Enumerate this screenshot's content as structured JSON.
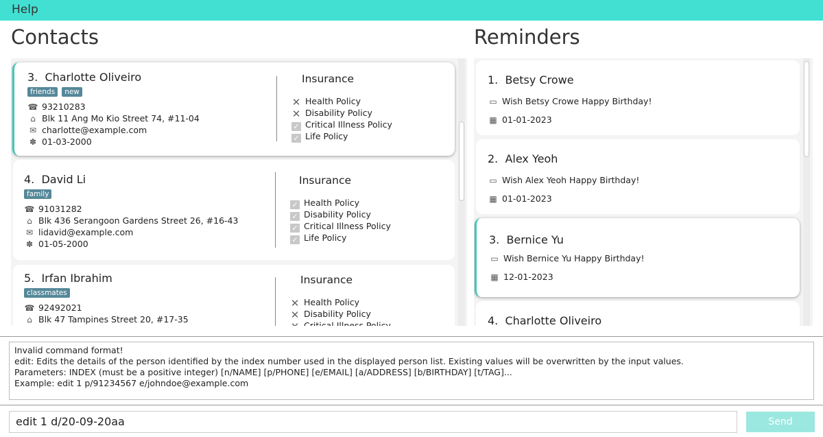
{
  "menu": {
    "help": "Help"
  },
  "contacts": {
    "title": "Contacts",
    "cards": [
      {
        "index": "3.",
        "name": "Charlotte Oliveiro",
        "tags": [
          "friends",
          "new"
        ],
        "phone": "93210283",
        "address": "Blk 11 Ang Mo Kio Street 74, #11-04",
        "email": "charlotte@example.com",
        "birthday": "01-03-2000",
        "insurance_title": "Insurance",
        "policies": [
          {
            "label": "Health Policy",
            "state": "x"
          },
          {
            "label": "Disability Policy",
            "state": "x"
          },
          {
            "label": "Critical Illness Policy",
            "state": "check"
          },
          {
            "label": "Life Policy",
            "state": "check"
          }
        ]
      },
      {
        "index": "4.",
        "name": "David Li",
        "tags": [
          "family"
        ],
        "phone": "91031282",
        "address": "Blk 436 Serangoon Gardens Street 26, #16-43",
        "email": "lidavid@example.com",
        "birthday": "01-05-2000",
        "insurance_title": "Insurance",
        "policies": [
          {
            "label": "Health Policy",
            "state": "check"
          },
          {
            "label": "Disability Policy",
            "state": "check"
          },
          {
            "label": "Critical Illness Policy",
            "state": "check"
          },
          {
            "label": "Life Policy",
            "state": "check"
          }
        ]
      },
      {
        "index": "5.",
        "name": "Irfan Ibrahim",
        "tags": [
          "classmates"
        ],
        "phone": "92492021",
        "address": "Blk 47 Tampines Street 20, #17-35",
        "insurance_title": "Insurance",
        "policies": [
          {
            "label": "Health Policy",
            "state": "x"
          },
          {
            "label": "Disability Policy",
            "state": "x"
          },
          {
            "label": "Critical Illness Policy",
            "state": "x"
          }
        ]
      }
    ]
  },
  "reminders": {
    "title": "Reminders",
    "cards": [
      {
        "index": "1.",
        "name": "Betsy Crowe",
        "message": "Wish Betsy Crowe Happy Birthday!",
        "date": "01-01-2023"
      },
      {
        "index": "2.",
        "name": "Alex Yeoh",
        "message": "Wish Alex Yeoh Happy Birthday!",
        "date": "01-01-2023"
      },
      {
        "index": "3.",
        "name": "Bernice Yu",
        "message": "Wish Bernice Yu Happy Birthday!",
        "date": "12-01-2023"
      },
      {
        "index": "4.",
        "name": "Charlotte Oliveiro"
      }
    ]
  },
  "result": {
    "lines": [
      "Invalid command format!",
      "edit: Edits the details of the person identified by the index number used in the displayed person list. Existing values will be overwritten by the input values.",
      "Parameters: INDEX (must be a positive integer) [n/NAME] [p/PHONE] [e/EMAIL] [a/ADDRESS] [b/BIRTHDAY] [t/TAG]...",
      "Example: edit 1 p/91234567 e/johndoe@example.com"
    ]
  },
  "command": {
    "value": "edit 1 d/20-09-20aa",
    "send_label": "Send"
  },
  "icons": {
    "phone": "phone-icon",
    "address": "house-icon",
    "email": "email-icon",
    "birthday": "cake-icon",
    "note": "note-icon",
    "calendar": "calendar-icon"
  },
  "colors": {
    "menubar": "#41e0d3",
    "tag": "#558899",
    "selection": "#41c8b8",
    "send": "#9be8e0"
  }
}
